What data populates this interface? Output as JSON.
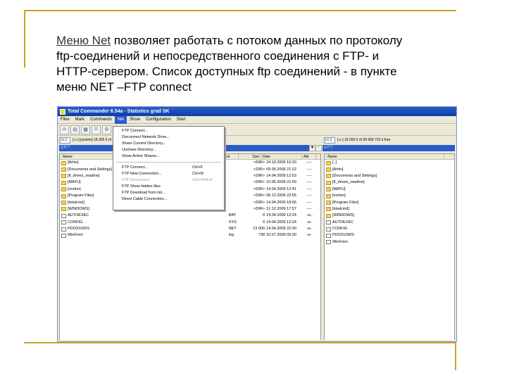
{
  "slide": {
    "line1_prefix": "Меню Net",
    "line1_rest": " позволяет работать с потоком данных по протоколу",
    "line2": "ftp-соединений и непосредственного соединения с FTP- и",
    "line3": "HTTP-сервером.  Список доступных ftp соединений - в пункте",
    "line4": "меню NET –FTP connect"
  },
  "window": {
    "title": "Total Commander 6.54a - Statistics grad SK",
    "menu": [
      "Files",
      "Mark",
      "Commands",
      "Net",
      "Show",
      "Configuration",
      "Start"
    ],
    "active_menu_index": 3,
    "toolbar_icons": [
      "refresh-icon",
      "view-brief-icon",
      "view-full-icon",
      "tree-icon",
      "extra-icon"
    ]
  },
  "left_panel": {
    "drive": "[-c-]",
    "drive_info": "[-c-] [system] 18 265 0 of 39 999 720 k free",
    "path": "c:\\*.*",
    "headers": [
      "↑Name",
      "Ext",
      "Size",
      "Date",
      "Attr"
    ],
    "rows": [
      {
        "name": "[Arhiv]",
        "ext": "",
        "size": "<DIR>",
        "date": "24.10.2009 15:20",
        "attr": "----",
        "type": "folder"
      },
      {
        "name": "[Documents and Settings]",
        "ext": "",
        "size": "<DIR>",
        "date": "09.05.2009 21:22",
        "attr": "----",
        "type": "folder"
      },
      {
        "name": "[II_drives_readme]",
        "ext": "",
        "size": "<DIR>",
        "date": "14.04.2009 12:53",
        "attr": "----",
        "type": "folder"
      },
      {
        "name": "[MAYU]",
        "ext": "",
        "size": "<DIR>",
        "date": "10.05.2009 21:00",
        "attr": "----",
        "type": "folder"
      },
      {
        "name": "[norton]",
        "ext": "",
        "size": "<DIR>",
        "date": "14.04.2009 12:41",
        "attr": "----",
        "type": "folder"
      },
      {
        "name": "[Program Files]",
        "ext": "",
        "size": "<DIR>",
        "date": "06.12.2009 22:55",
        "attr": "----",
        "type": "folder"
      },
      {
        "name": "[totalcmd]",
        "ext": "",
        "size": "<DIR>",
        "date": "14.04.2009 18:06",
        "attr": "----",
        "type": "folder"
      },
      {
        "name": "[WINDOWS]",
        "ext": "",
        "size": "<DIR>",
        "date": "12.12.2009 17:57",
        "attr": "----",
        "type": "folder"
      },
      {
        "name": "AUTOEXEC",
        "ext": "BAT",
        "size": "0",
        "date": "14.04.2009 12:24",
        "attr": "-a--",
        "type": "file"
      },
      {
        "name": "CONFIG",
        "ext": "SYS",
        "size": "0",
        "date": "14.04.2009 12:24",
        "attr": "-a--",
        "type": "file"
      },
      {
        "name": "PDOXUSRS",
        "ext": "NET",
        "size": "13 000",
        "date": "14.04.2009 22:30",
        "attr": "-a--",
        "type": "file"
      },
      {
        "name": "WinFmm",
        "ext": "log",
        "size": "738",
        "date": "10.07.2009 09:30",
        "attr": "-a--",
        "type": "file"
      }
    ]
  },
  "right_panel": {
    "drive": "[-c-]",
    "drive_info": "[-c-] 18 265 0 of 39 999 720 k free",
    "path": "c:\\*.*",
    "headers": [
      "↑Name"
    ],
    "rows": [
      {
        "name": "[..]",
        "type": "folder"
      },
      {
        "name": "[Arhiv]",
        "type": "folder"
      },
      {
        "name": "[Documents and Settings]",
        "type": "folder"
      },
      {
        "name": "[II_drives_readme]",
        "type": "folder"
      },
      {
        "name": "[MAYU]",
        "type": "folder"
      },
      {
        "name": "[norton]",
        "type": "folder"
      },
      {
        "name": "[Program Files]",
        "type": "folder"
      },
      {
        "name": "[totalcmd]",
        "type": "folder"
      },
      {
        "name": "[WINDOWS]",
        "type": "folder"
      },
      {
        "name": "AUTOEXEC",
        "type": "file"
      },
      {
        "name": "CONFIG",
        "type": "file"
      },
      {
        "name": "PDOXUSRS",
        "type": "file"
      },
      {
        "name": "WinFmm",
        "type": "file"
      }
    ]
  },
  "net_menu": {
    "items": [
      {
        "label": "FTP Connect...",
        "key": "",
        "disabled": false
      },
      {
        "label": "Disconnect Network Drive...",
        "key": "",
        "disabled": false
      },
      {
        "label": "Share Current Directory...",
        "key": "",
        "disabled": false
      },
      {
        "label": "Unshare Directory...",
        "key": "",
        "disabled": false
      },
      {
        "label": "Show Active Shares...",
        "key": "",
        "disabled": false
      },
      {
        "sep": true
      },
      {
        "label": "FTP Connect...",
        "key": "Ctrl+F",
        "disabled": false
      },
      {
        "label": "FTP New Connection...",
        "key": "Ctrl+N",
        "disabled": false
      },
      {
        "label": "FTP Disconnect",
        "key": "Ctrl+Shift+F",
        "disabled": true
      },
      {
        "label": "FTP Show hidden files",
        "key": "",
        "disabled": false
      },
      {
        "label": "FTP Download from list...",
        "key": "",
        "disabled": false
      },
      {
        "label": "Direct Cable Connection...",
        "key": "",
        "disabled": false
      }
    ]
  },
  "colors": {
    "accent": "#2b5bc9",
    "slide_rule": "#c9a227"
  }
}
